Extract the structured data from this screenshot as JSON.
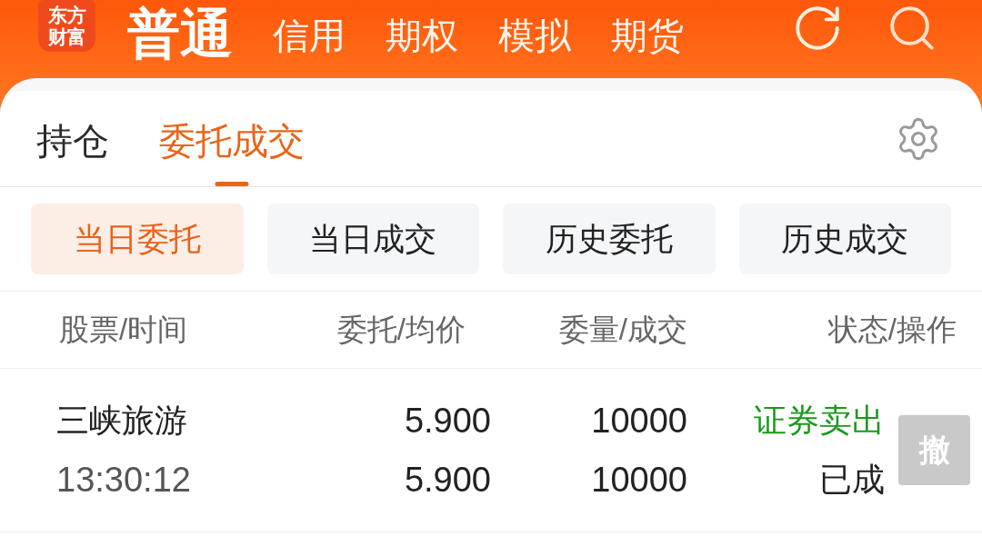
{
  "header": {
    "logo": "东方财富",
    "account_tabs": [
      {
        "label": "普通",
        "selected": true
      },
      {
        "label": "信用",
        "selected": false
      },
      {
        "label": "期权",
        "selected": false
      },
      {
        "label": "模拟",
        "selected": false
      },
      {
        "label": "期货",
        "selected": false
      }
    ]
  },
  "main_tabs": [
    {
      "label": "持仓",
      "selected": false
    },
    {
      "label": "委托成交",
      "selected": true
    }
  ],
  "sub_tabs": [
    {
      "label": "当日委托",
      "selected": true
    },
    {
      "label": "当日成交",
      "selected": false
    },
    {
      "label": "历史委托",
      "selected": false
    },
    {
      "label": "历史成交",
      "selected": false
    }
  ],
  "table": {
    "columns": [
      "股票/时间",
      "委托/均价",
      "委量/成交",
      "状态/操作"
    ],
    "rows": [
      {
        "stock": "三峡旅游",
        "time": "13:30:12",
        "order_price": "5.900",
        "avg_price": "5.900",
        "order_qty": "10000",
        "filled_qty": "10000",
        "direction": "证券卖出",
        "color": "#1a9a1a",
        "status": "已成",
        "cancel": {
          "label": "撤",
          "disabled": true
        }
      }
    ]
  }
}
